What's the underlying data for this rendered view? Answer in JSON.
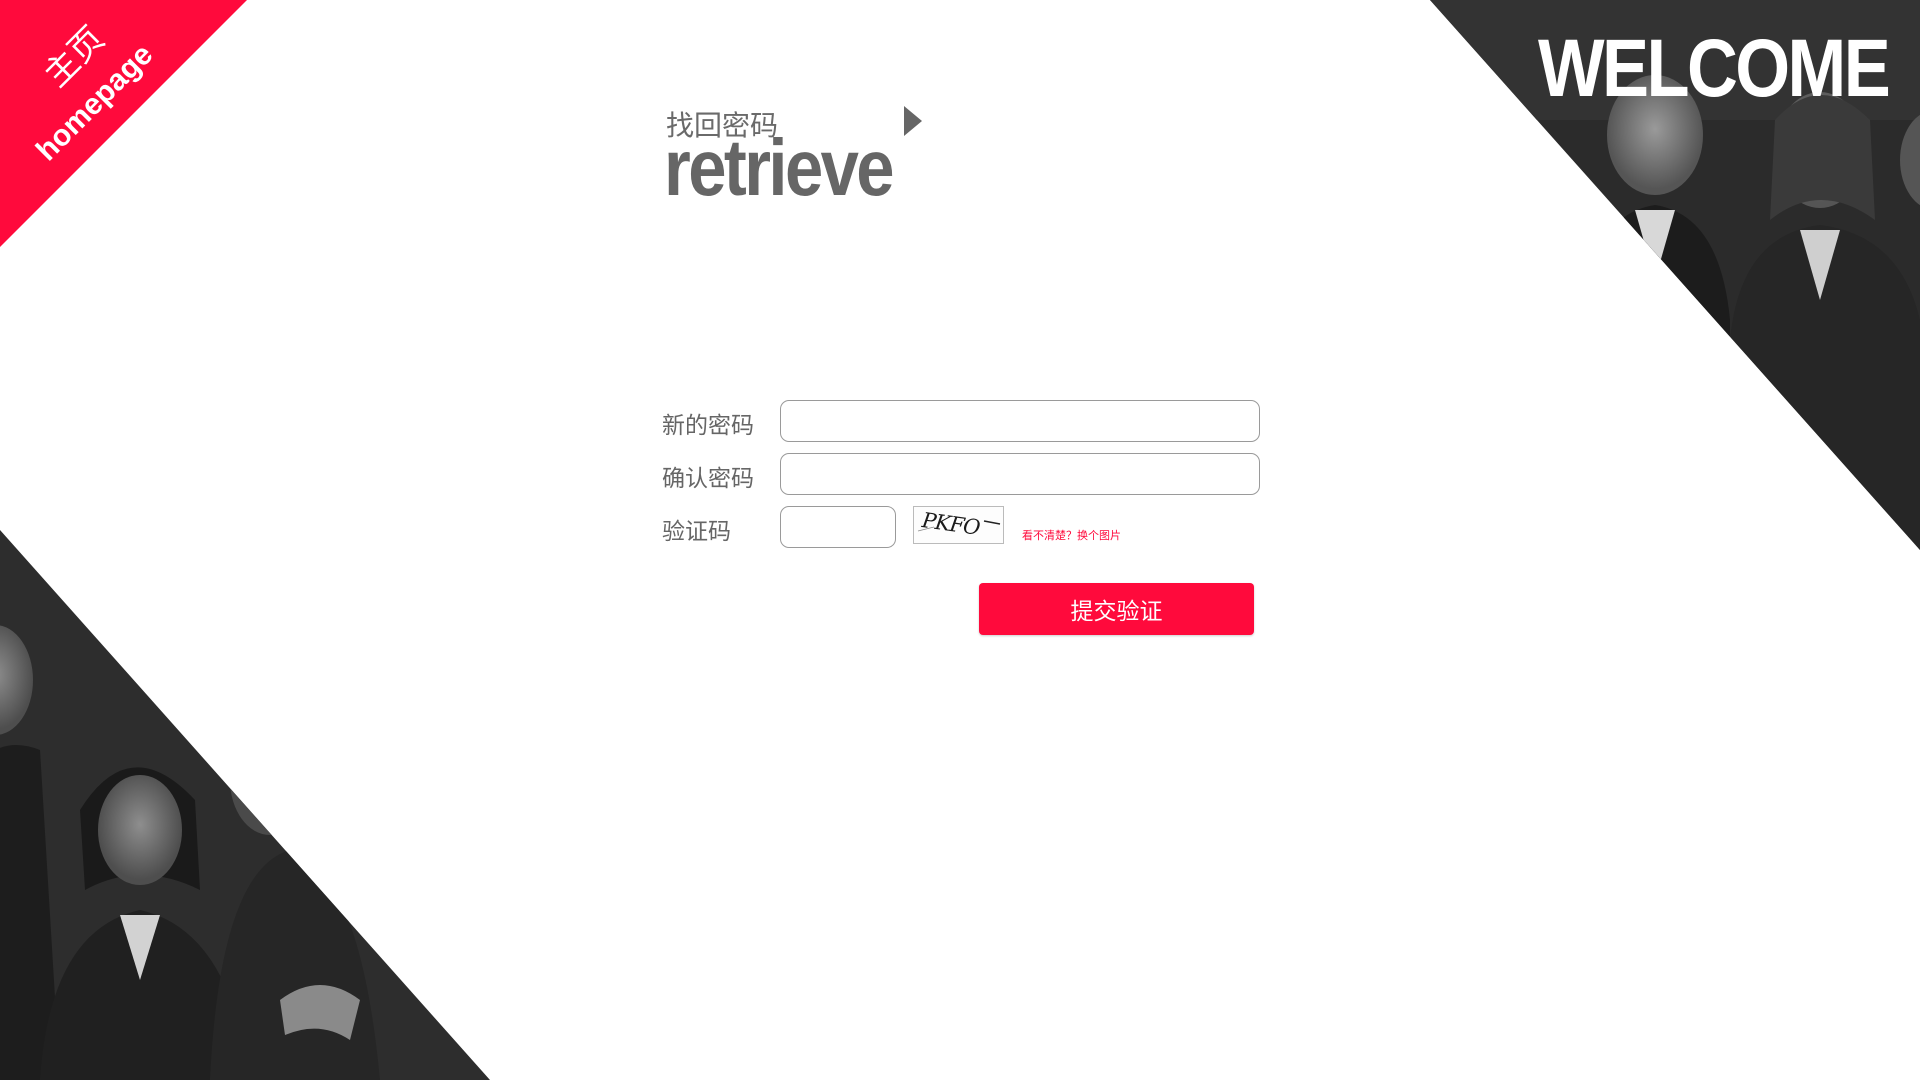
{
  "corner": {
    "title_cn": "主页",
    "title_en": "homepage",
    "color": "#ff0a3c"
  },
  "welcome": "WELCOME",
  "heading": {
    "cn": "找回密码",
    "en": "retrieve",
    "arrow_icon": "triangle-right-icon"
  },
  "form": {
    "new_password_label": "新的密码",
    "confirm_password_label": "确认密码",
    "captcha_label": "验证码",
    "new_password_value": "",
    "confirm_password_value": "",
    "captcha_value": "",
    "captcha_image_text": "PKFO",
    "captcha_refresh_link": "看不清楚？换个图片",
    "submit_label": "提交验证"
  },
  "colors": {
    "accent": "#ff0a3c",
    "text_gray": "#666666",
    "photo_dark": "#2c2c2c"
  }
}
